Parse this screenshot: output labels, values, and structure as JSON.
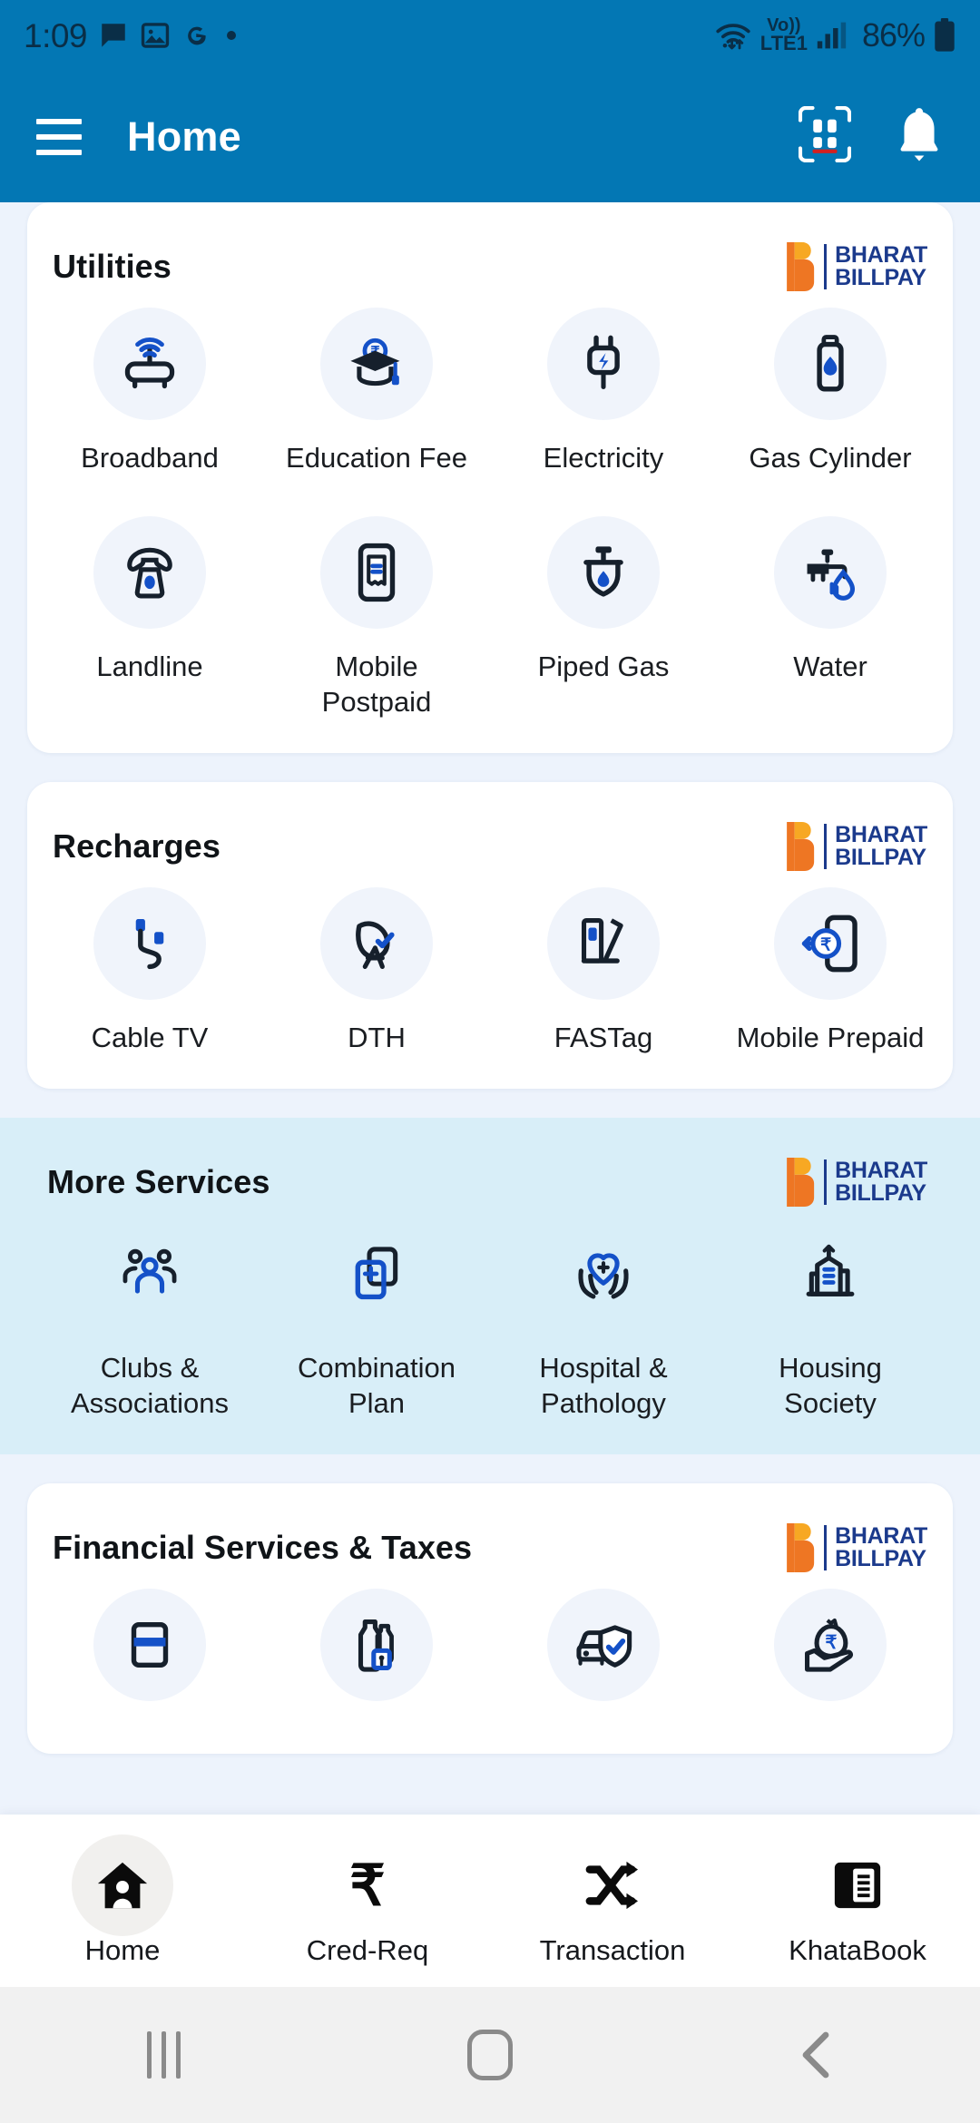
{
  "status_bar": {
    "time": "1:09",
    "left_icons": [
      "message-icon",
      "image-icon",
      "google-icon",
      "dot-icon"
    ],
    "network_label_top": "Vo))",
    "network_label_bottom": "LTE1",
    "battery_percent": "86%",
    "icons": [
      "wifi-icon",
      "volte-icon",
      "signal-icon",
      "battery-icon"
    ]
  },
  "appbar": {
    "title": "Home",
    "menu_icon": "hamburger-menu-icon",
    "scan_icon": "qr-scanner-icon",
    "notification_icon": "bell-icon"
  },
  "bbps_logo": {
    "line1": "BHARAT",
    "line2": "BILLPAY",
    "b_color_top": "#F5A623",
    "b_color_bottom": "#EE7623",
    "text_color": "#1B3A8C"
  },
  "colors": {
    "header_blue": "#0377B4",
    "page_bg": "#EDF3FC",
    "card_bg": "#FFFFFF",
    "band_bg": "#D8EEF8",
    "icon_circle": "#F0F4FB",
    "icon_dark": "#16202C",
    "icon_accent_blue": "#1451C8"
  },
  "sections": [
    {
      "id": "utilities",
      "title": "Utilities",
      "style": "card",
      "tiles": [
        {
          "label": "Broadband",
          "icon": "broadband-router-icon"
        },
        {
          "label": "Education Fee",
          "icon": "graduation-cap-rupee-icon"
        },
        {
          "label": "Electricity",
          "icon": "electric-plug-icon"
        },
        {
          "label": "Gas Cylinder",
          "icon": "gas-cylinder-icon"
        },
        {
          "label": "Landline",
          "icon": "landline-telephone-icon"
        },
        {
          "label": "Mobile Postpaid",
          "icon": "mobile-bill-icon"
        },
        {
          "label": "Piped Gas",
          "icon": "piped-gas-icon"
        },
        {
          "label": "Water",
          "icon": "water-tap-icon"
        }
      ]
    },
    {
      "id": "recharges",
      "title": "Recharges",
      "style": "card",
      "tiles": [
        {
          "label": "Cable TV",
          "icon": "cable-connector-icon"
        },
        {
          "label": "DTH",
          "icon": "satellite-dish-icon"
        },
        {
          "label": "FASTag",
          "icon": "toll-booth-icon"
        },
        {
          "label": "Mobile Prepaid",
          "icon": "mobile-rupee-recharge-icon"
        }
      ]
    },
    {
      "id": "more-services",
      "title": "More Services",
      "style": "band",
      "tiles": [
        {
          "label": "Clubs & Associations",
          "icon": "people-group-icon"
        },
        {
          "label": "Combination Plan",
          "icon": "combination-plan-icon"
        },
        {
          "label": "Hospital & Pathology",
          "icon": "hands-heart-care-icon"
        },
        {
          "label": "Housing Society",
          "icon": "apartment-building-icon"
        }
      ]
    },
    {
      "id": "financial-services",
      "title": "Financial Services & Taxes",
      "style": "card",
      "tiles": [
        {
          "label": "",
          "icon": "credit-card-icon"
        },
        {
          "label": "",
          "icon": "milk-bottles-icon"
        },
        {
          "label": "",
          "icon": "vehicle-insurance-icon"
        },
        {
          "label": "",
          "icon": "loan-money-bag-icon"
        }
      ]
    }
  ],
  "bottom_nav": [
    {
      "label": "Home",
      "icon": "home-person-icon",
      "active": true
    },
    {
      "label": "Cred-Req",
      "icon": "rupee-icon",
      "active": false
    },
    {
      "label": "Transaction",
      "icon": "shuffle-arrows-icon",
      "active": false
    },
    {
      "label": "KhataBook",
      "icon": "ledger-book-icon",
      "active": false
    }
  ],
  "android_nav": {
    "recents": "recents-icon",
    "home": "home-pill-icon",
    "back": "back-chevron-icon"
  }
}
